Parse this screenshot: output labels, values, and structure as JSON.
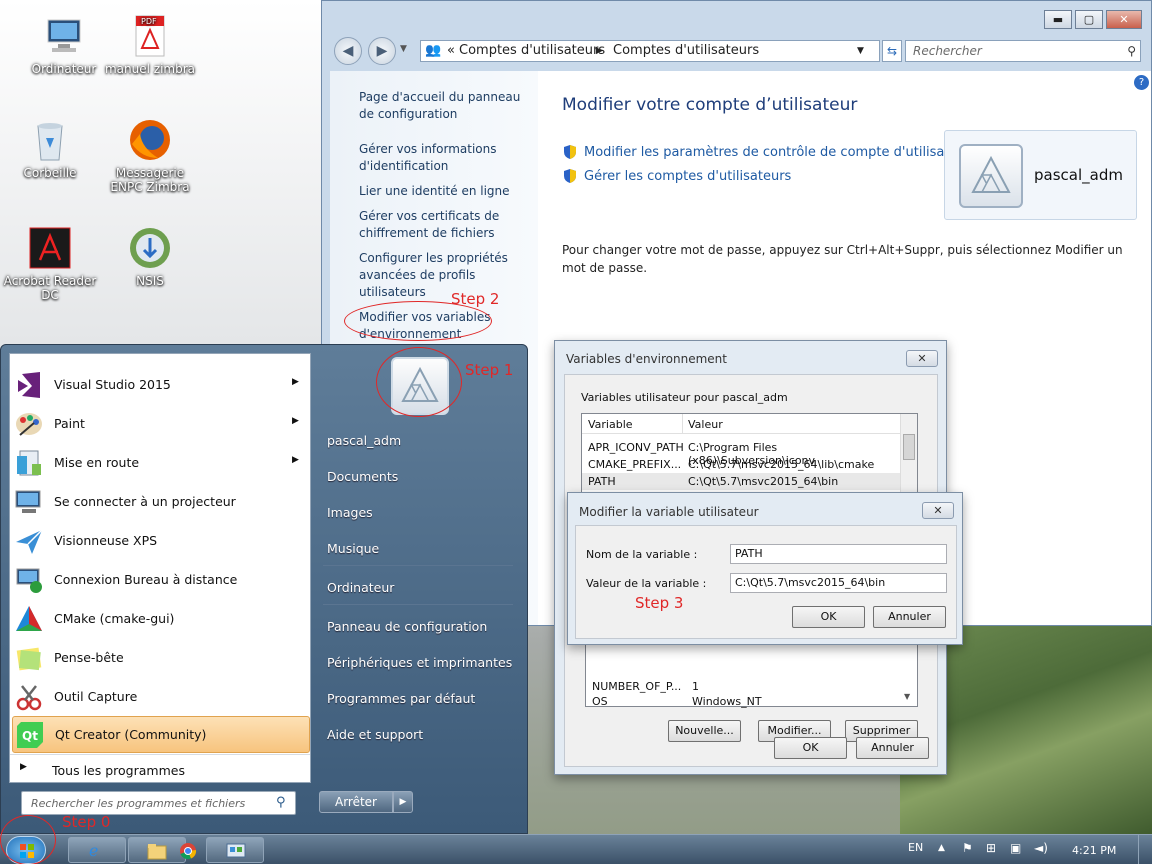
{
  "desktop": {
    "icons": [
      {
        "label": "Ordinateur",
        "icon": "computer-icon"
      },
      {
        "label": "manuel zimbra",
        "icon": "pdf-icon"
      },
      {
        "label": "Corbeille",
        "icon": "recycle-bin-icon"
      },
      {
        "label": "Messagerie ENPC Zimbra",
        "icon": "firefox-icon"
      },
      {
        "label": "Acrobat Reader DC",
        "icon": "acrobat-icon"
      },
      {
        "label": "NSIS",
        "icon": "nsis-icon"
      }
    ]
  },
  "control_panel": {
    "breadcrumb": [
      "«",
      "Comptes d'utilisateurs",
      "Comptes d'utilisateurs"
    ],
    "search_placeholder": "Rechercher",
    "left_links": [
      "Page d'accueil du panneau de configuration",
      "Gérer vos informations d'identification",
      "Lier une identité en ligne",
      "Gérer vos certificats de chiffrement de fichiers",
      "Configurer les propriétés avancées de profils utilisateurs",
      "Modifier vos variables d'environnement"
    ],
    "title": "Modifier votre compte d’utilisateur",
    "links": [
      "Modifier les paramètres de contrôle de compte d'utilisateur",
      "Gérer les comptes d'utilisateurs"
    ],
    "user": "pascal_adm",
    "info": "Pour changer votre mot de passe, appuyez sur Ctrl+Alt+Suppr, puis sélectionnez Modifier un mot de passe."
  },
  "env_dialog": {
    "title": "Variables d'environnement",
    "group_label": "Variables utilisateur pour pascal_adm",
    "columns": [
      "Variable",
      "Valeur"
    ],
    "rows": [
      [
        "APR_ICONV_PATH",
        "C:\\Program Files (x86)\\Subversion\\iconv"
      ],
      [
        "CMAKE_PREFIX...",
        "C:\\Qt\\5.7\\msvc2015_64\\lib\\cmake"
      ],
      [
        "PATH",
        "C:\\Qt\\5.7\\msvc2015_64\\bin"
      ]
    ],
    "sys_rows": [
      [
        "NUMBER_OF_P...",
        "1"
      ],
      [
        "OS",
        "Windows_NT"
      ]
    ],
    "buttons": [
      "Nouvelle...",
      "Modifier...",
      "Supprimer"
    ],
    "ok": "OK",
    "cancel": "Annuler"
  },
  "edit_dialog": {
    "title": "Modifier la variable utilisateur",
    "name_label": "Nom de la variable :",
    "name_value": "PATH",
    "value_label": "Valeur de la variable :",
    "value_value": "C:\\Qt\\5.7\\msvc2015_64\\bin",
    "ok": "OK",
    "cancel": "Annuler"
  },
  "start_menu": {
    "programs": [
      {
        "label": "Visual Studio 2015",
        "icon": "visual-studio-icon",
        "arrow": "▶"
      },
      {
        "label": "Paint",
        "icon": "paint-icon",
        "arrow": "▶"
      },
      {
        "label": "Mise en route",
        "icon": "getting-started-icon",
        "arrow": "▶"
      },
      {
        "label": "Se connecter à un projecteur",
        "icon": "projector-icon",
        "arrow": ""
      },
      {
        "label": "Visionneuse XPS",
        "icon": "xps-viewer-icon",
        "arrow": ""
      },
      {
        "label": "Connexion Bureau à distance",
        "icon": "remote-desktop-icon",
        "arrow": ""
      },
      {
        "label": "CMake (cmake-gui)",
        "icon": "cmake-icon",
        "arrow": ""
      },
      {
        "label": "Pense-bête",
        "icon": "sticky-notes-icon",
        "arrow": ""
      },
      {
        "label": "Outil Capture",
        "icon": "snipping-tool-icon",
        "arrow": ""
      },
      {
        "label": "Qt Creator (Community)",
        "icon": "qt-creator-icon",
        "arrow": ""
      }
    ],
    "all_programs": "Tous les programmes",
    "search_placeholder": "Rechercher les programmes et fichiers",
    "right_items": [
      "pascal_adm",
      "Documents",
      "Images",
      "Musique",
      "Ordinateur",
      "Panneau de configuration",
      "Périphériques et imprimantes",
      "Programmes par défaut",
      "Aide et support"
    ],
    "shutdown": "Arrêter"
  },
  "annotations": {
    "step0": "Step 0",
    "step1": "Step 1",
    "step2": "Step 2",
    "step3": "Step 3"
  },
  "taskbar": {
    "lang": "EN",
    "time": "4:21 PM"
  }
}
